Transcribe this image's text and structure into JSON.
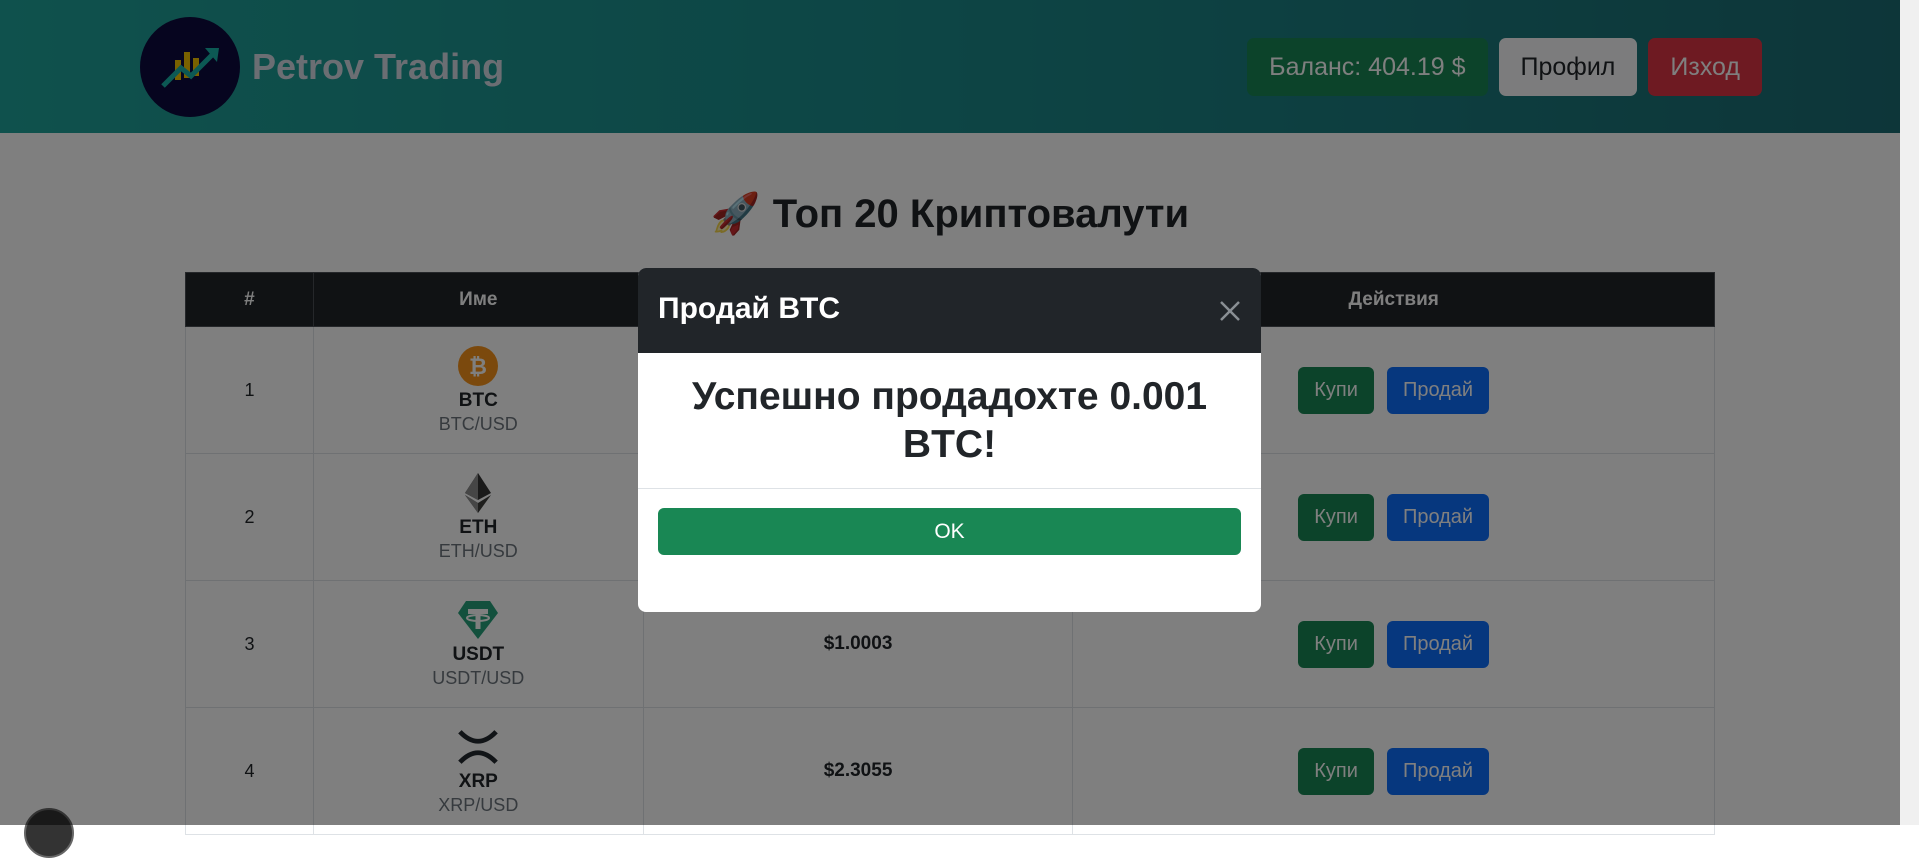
{
  "header": {
    "brand_name": "Petrov Trading",
    "balance_label": "Баланс: 404.19 $",
    "profile_label": "Профил",
    "logout_label": "Изход"
  },
  "main": {
    "title": "Топ 20 Криптовалути",
    "title_icon": "rocket-icon",
    "table": {
      "columns": [
        "#",
        "Име",
        "Действия"
      ],
      "rows": [
        {
          "rank": "1",
          "symbol": "BTC",
          "pair": "BTC/USD",
          "price": "",
          "icon": "bitcoin-icon",
          "buy": "Купи",
          "sell": "Продай"
        },
        {
          "rank": "2",
          "symbol": "ETH",
          "pair": "ETH/USD",
          "price": "",
          "icon": "ethereum-icon",
          "buy": "Купи",
          "sell": "Продай"
        },
        {
          "rank": "3",
          "symbol": "USDT",
          "pair": "USDT/USD",
          "price": "$1.0003",
          "icon": "tether-icon",
          "buy": "Купи",
          "sell": "Продай"
        },
        {
          "rank": "4",
          "symbol": "XRP",
          "pair": "XRP/USD",
          "price": "$2.3055",
          "icon": "xrp-icon",
          "buy": "Купи",
          "sell": "Продай"
        }
      ]
    }
  },
  "modal": {
    "title": "Продай BTC",
    "message": "Успешно продадохте 0.001 BTC!",
    "ok_label": "OK"
  },
  "colors": {
    "header_start": "#1fa39a",
    "header_end": "#1b6c73",
    "success": "#198754",
    "primary": "#0d6efd",
    "danger": "#dc3545",
    "dark": "#212529"
  }
}
